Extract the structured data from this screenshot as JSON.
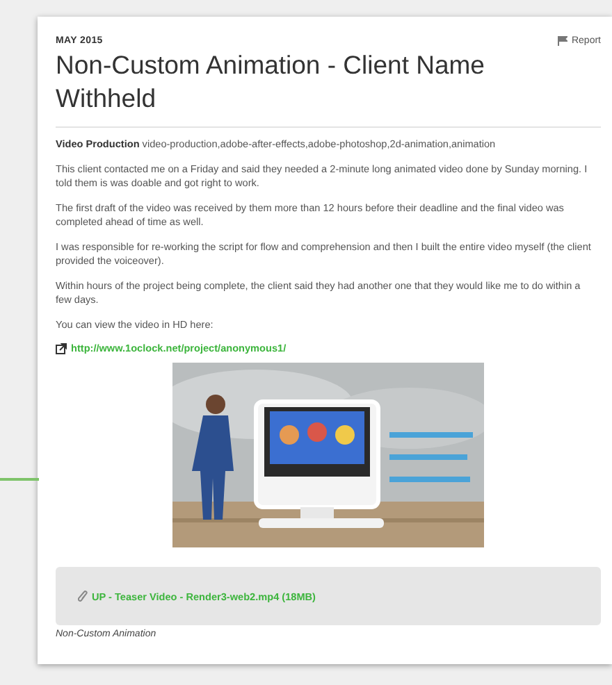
{
  "date": "MAY 2015",
  "report": {
    "label": "Report"
  },
  "title": "Non-Custom Animation - Client Name Withheld",
  "category": "**Video Production** video-production,adobe-after-effects,adobe-photoshop,2d-animation,animation",
  "paragraphs": [
    "This client contacted me on a Friday and said they needed a 2-minute long animated video done by Sunday morning. I told them is was doable and got right to work.",
    "The first draft of the video was received by them more than 12 hours before their deadline and the final video was completed ahead of time as well.",
    "I was responsible for re-working the script for flow and comprehension and then I built the entire video myself (the client provided the voiceover).",
    "Within hours of the project being complete, the client said they had another one that they would like me to do within a few days.",
    "You can view the video in HD here:"
  ],
  "link": "http://www.1oclock.net/project/anonymous1/",
  "attachment": "UP - Teaser Video - Render3-web2.mp4 (18MB)",
  "caption": "Non-Custom Animation"
}
